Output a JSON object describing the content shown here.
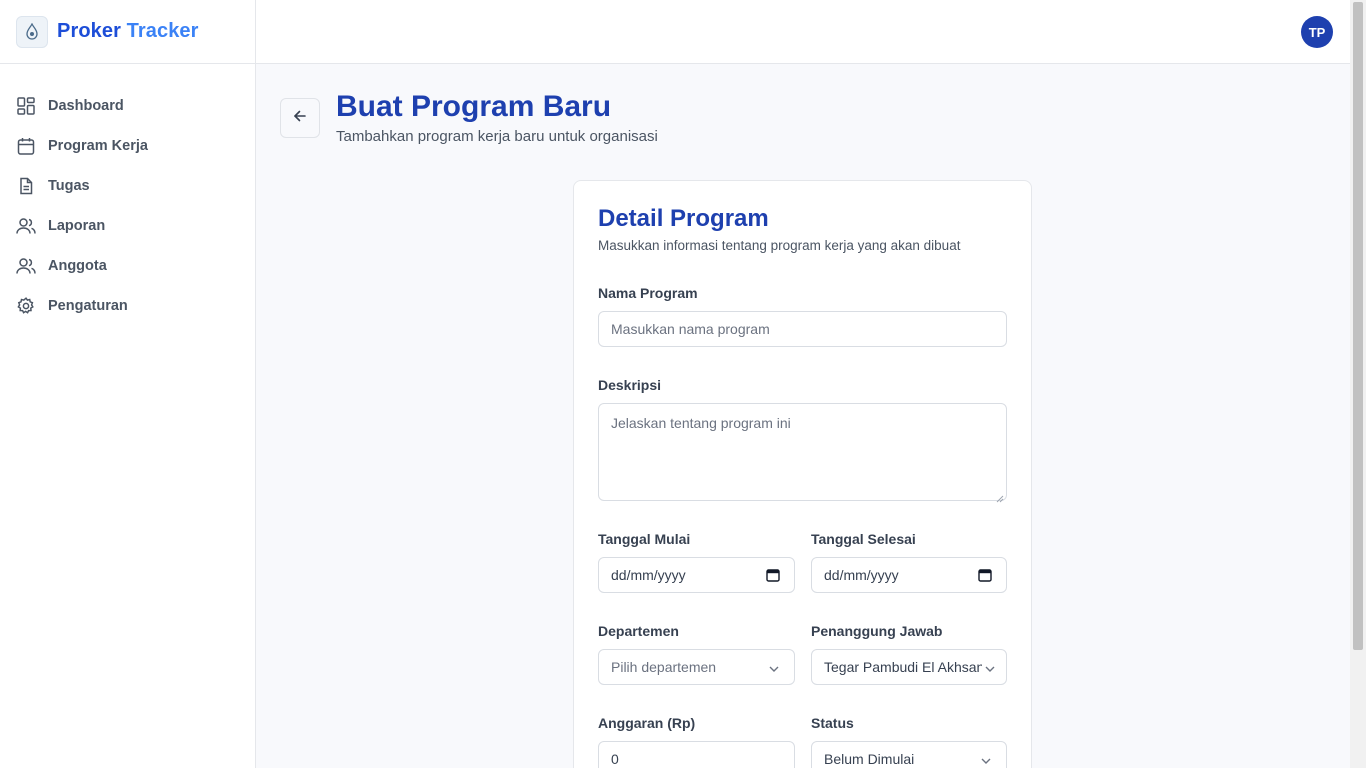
{
  "app": {
    "name_part1": "Proker",
    "name_part2": "Tracker"
  },
  "sidebar": {
    "items": [
      {
        "label": "Dashboard",
        "icon": "dashboard-icon"
      },
      {
        "label": "Program Kerja",
        "icon": "calendar-icon"
      },
      {
        "label": "Tugas",
        "icon": "document-icon"
      },
      {
        "label": "Laporan",
        "icon": "users-icon"
      },
      {
        "label": "Anggota",
        "icon": "users-icon"
      },
      {
        "label": "Pengaturan",
        "icon": "gear-icon"
      }
    ]
  },
  "header": {
    "avatar_initials": "TP"
  },
  "page": {
    "title": "Buat Program Baru",
    "subtitle": "Tambahkan program kerja baru untuk organisasi"
  },
  "form": {
    "title": "Detail Program",
    "description": "Masukkan informasi tentang program kerja yang akan dibuat",
    "name": {
      "label": "Nama Program",
      "placeholder": "Masukkan nama program"
    },
    "description_field": {
      "label": "Deskripsi",
      "placeholder": "Jelaskan tentang program ini"
    },
    "start_date": {
      "label": "Tanggal Mulai",
      "placeholder": "dd/mm/yyyy"
    },
    "end_date": {
      "label": "Tanggal Selesai",
      "placeholder": "dd/mm/yyyy"
    },
    "department": {
      "label": "Departemen",
      "placeholder": "Pilih departemen"
    },
    "pic": {
      "label": "Penanggung Jawab",
      "value": "Tegar Pambudi El Akhsan"
    },
    "budget": {
      "label": "Anggaran (Rp)",
      "value": "0"
    },
    "status": {
      "label": "Status",
      "value": "Belum Dimulai"
    }
  },
  "colors": {
    "primary": "#1e40af",
    "accent": "#3b82f6"
  }
}
